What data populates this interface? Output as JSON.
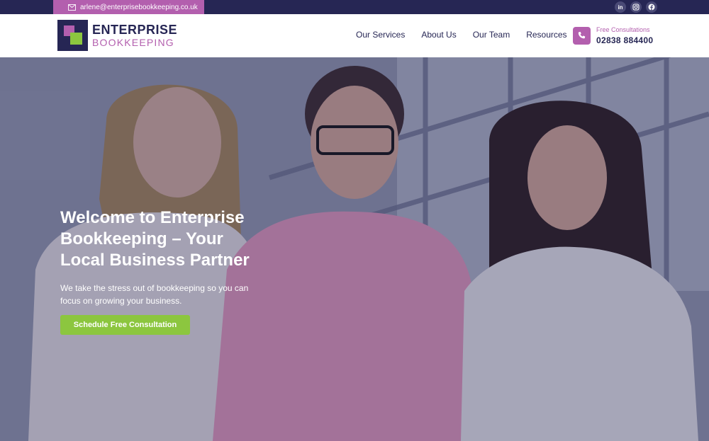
{
  "topbar": {
    "email": "arlene@enterprisebookkeeping.co.uk",
    "socials": [
      {
        "name": "linkedin-icon",
        "glyph": "in"
      },
      {
        "name": "instagram-icon",
        "glyph": "◎"
      },
      {
        "name": "facebook-icon",
        "glyph": "f"
      }
    ]
  },
  "header": {
    "logo_line1": "ENTERPRISE",
    "logo_line2": "BOOKKEEPING",
    "nav": [
      "Our Services",
      "About Us",
      "Our Team",
      "Resources"
    ],
    "phone_label": "Free Consultations",
    "phone_number": "02838 884400"
  },
  "hero": {
    "title": "Welcome to Enterprise Bookkeeping – Your Local Business Partner",
    "subtitle": "We take the stress out of bookkeeping so you can focus on growing your business.",
    "cta_label": "Schedule Free Consultation"
  },
  "colors": {
    "navy": "#262654",
    "pink": "#b35fae",
    "green": "#8cc63f"
  }
}
